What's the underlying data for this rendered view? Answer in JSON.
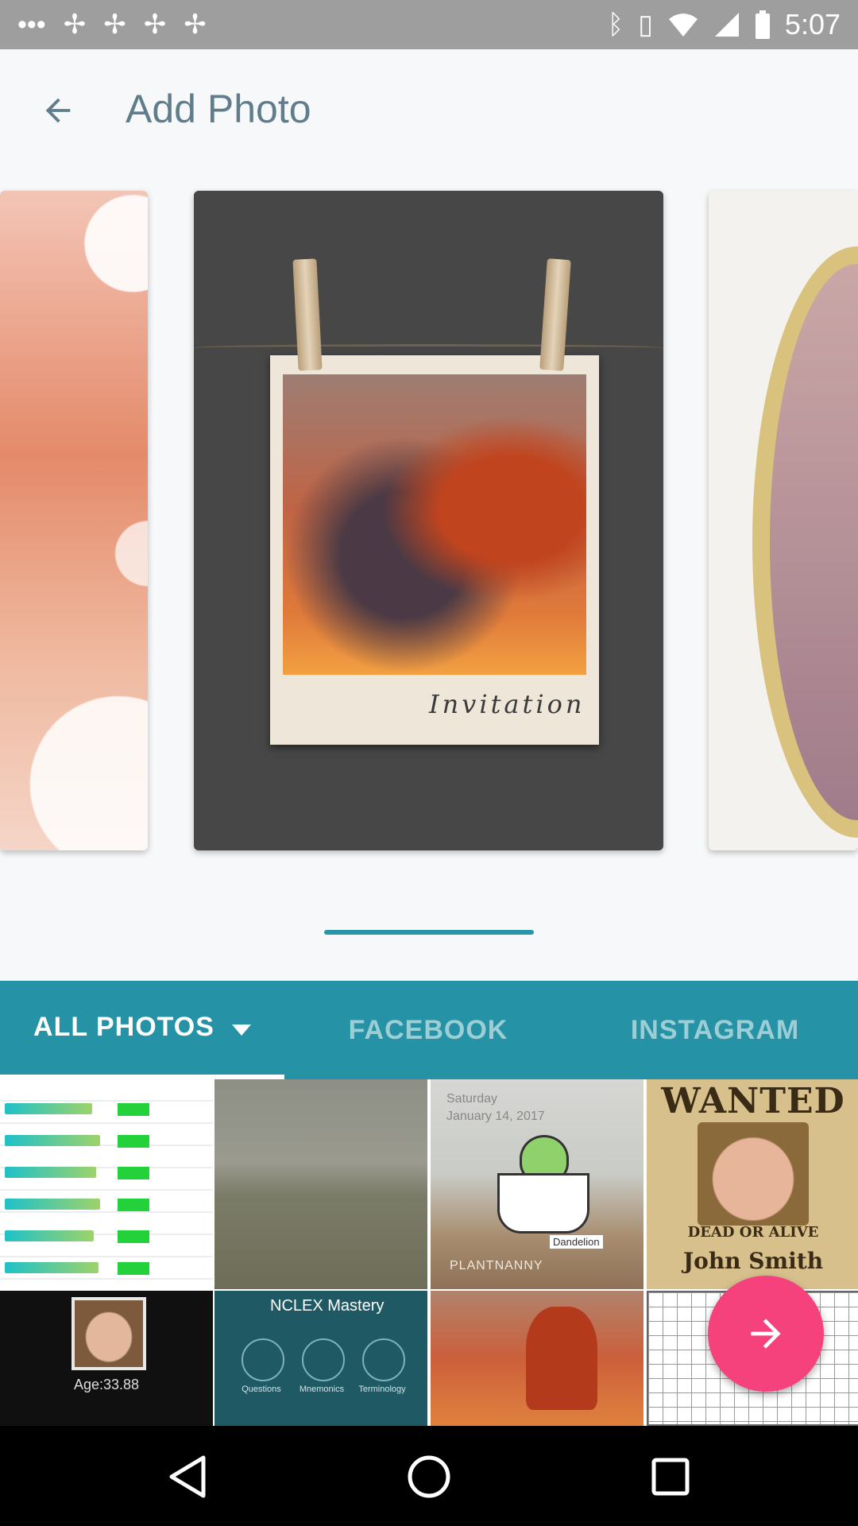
{
  "status_bar": {
    "time": "5:07",
    "left_icons": [
      "more-icon",
      "notification-icon",
      "notification-icon",
      "notification-icon",
      "notification-icon"
    ],
    "right_icons": [
      "bluetooth-icon",
      "vibrate-icon",
      "wifi-icon",
      "signal-icon",
      "battery-icon"
    ]
  },
  "app_bar": {
    "title": "Add Photo",
    "back_icon": "arrow-back-icon"
  },
  "carousel": {
    "templates": [
      {
        "name": "lace-frame-template"
      },
      {
        "name": "polaroid-invitation-template",
        "caption": "Invitation"
      },
      {
        "name": "gold-ornate-frame-template"
      }
    ],
    "accent": "#2a95a6"
  },
  "tabs": {
    "items": [
      {
        "label": "ALL PHOTOS",
        "selected": true,
        "has_dropdown": true
      },
      {
        "label": "FACEBOOK",
        "selected": false
      },
      {
        "label": "INSTAGRAM",
        "selected": false
      }
    ],
    "background": "#2592a5"
  },
  "gallery": {
    "photos": [
      {
        "name": "settings-table-screenshot"
      },
      {
        "name": "floor-photo"
      },
      {
        "name": "plant-nanny-screenshot",
        "date_line1": "Saturday",
        "date_line2": "January 14, 2017",
        "label": "Dandelion",
        "brand": "PLANTNANNY"
      },
      {
        "name": "wanted-poster",
        "headline": "WANTED",
        "subline": "DEAD OR ALIVE",
        "person": "John Smith"
      },
      {
        "name": "age-estimate-screenshot",
        "text": "Age:33.88"
      },
      {
        "name": "nclex-app-screenshot",
        "title": "NCLEX Mastery",
        "items": [
          "Questions",
          "Mnemonics",
          "Terminology"
        ]
      },
      {
        "name": "sunset-portrait-photo"
      },
      {
        "name": "grid-paper-photo"
      }
    ]
  },
  "fab": {
    "icon": "arrow-forward-icon",
    "color": "#f5427d"
  },
  "nav_bar": {
    "icons": [
      "back-triangle-icon",
      "home-circle-icon",
      "recents-square-icon"
    ]
  }
}
